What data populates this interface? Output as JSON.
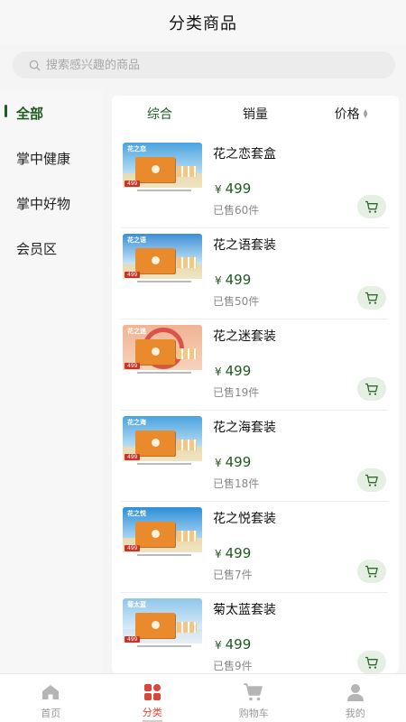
{
  "header": {
    "title": "分类商品"
  },
  "search": {
    "placeholder": "搜索感兴趣的商品"
  },
  "sidebar": {
    "items": [
      {
        "label": "全部",
        "active": true
      },
      {
        "label": "掌中健康",
        "active": false
      },
      {
        "label": "掌中好物",
        "active": false
      },
      {
        "label": "会员区",
        "active": false
      }
    ]
  },
  "sort": {
    "tabs": [
      {
        "label": "综合",
        "active": true
      },
      {
        "label": "销量",
        "active": false
      },
      {
        "label": "价格",
        "active": false
      }
    ]
  },
  "products": [
    {
      "name": "花之恋套盒",
      "currency": "¥",
      "price": "499",
      "sold": "已售60件",
      "thumb_brand": "花之恋",
      "thumb_price": "499"
    },
    {
      "name": "花之语套装",
      "currency": "¥",
      "price": "499",
      "sold": "已售50件",
      "thumb_brand": "花之语",
      "thumb_price": "499"
    },
    {
      "name": "花之迷套装",
      "currency": "¥",
      "price": "499",
      "sold": "已售19件",
      "thumb_brand": "花之迷",
      "thumb_price": "499"
    },
    {
      "name": "花之海套装",
      "currency": "¥",
      "price": "499",
      "sold": "已售18件",
      "thumb_brand": "花之海",
      "thumb_price": "499"
    },
    {
      "name": "花之悦套装",
      "currency": "¥",
      "price": "499",
      "sold": "已售7件",
      "thumb_brand": "花之悦",
      "thumb_price": "499"
    },
    {
      "name": "菊太蓝套装",
      "currency": "¥",
      "price": "499",
      "sold": "已售9件",
      "thumb_brand": "菊太蓝",
      "thumb_price": "499"
    }
  ],
  "tabbar": {
    "items": [
      {
        "label": "首页",
        "icon": "home-icon",
        "active": false
      },
      {
        "label": "分类",
        "icon": "category-icon",
        "active": true
      },
      {
        "label": "购物车",
        "icon": "cart-icon",
        "active": false
      },
      {
        "label": "我的",
        "icon": "user-icon",
        "active": false
      }
    ]
  },
  "colors": {
    "accent": "#1e5b1e",
    "tab_active": "#d9473a",
    "cart_bg": "#e6efe3"
  }
}
